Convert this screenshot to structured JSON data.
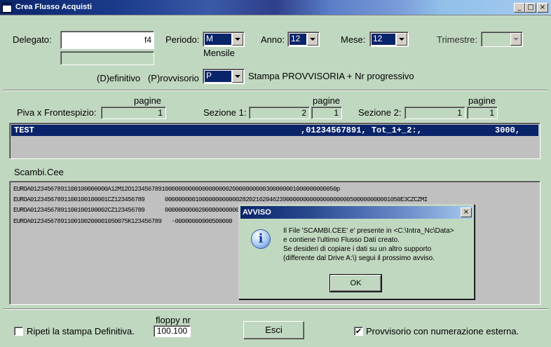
{
  "window": {
    "title": "Crea Flusso Acquisti",
    "min": "_",
    "max": "□",
    "close": "×"
  },
  "form": {
    "delegato_label": "Delegato:",
    "delegato_value": "",
    "delegato_fkey": "f4",
    "delegato_desc": "",
    "periodo_label": "Periodo:",
    "periodo_value": "M",
    "periodo_desc": "Mensile",
    "anno_label": "Anno:",
    "anno_value": "12",
    "mese_label": "Mese:",
    "mese_value": "12",
    "trimestre_label": "Trimestre:",
    "trimestre_value": "",
    "tipo_label": "(D)efinitivo   (P)rovvisorio",
    "tipo_value": "P",
    "tipo_desc": "Stampa PROVVISORIA + Nr progressivo"
  },
  "pages": {
    "pagine_label": "pagine",
    "frontespizio_label": "Piva x Frontespizio:",
    "frontespizio_value": "1",
    "sezione1_label": "Sezione 1:",
    "sezione1_value": "2",
    "sezione1_pages": "1",
    "sezione2_label": "Sezione 2:",
    "sezione2_value": "1",
    "sezione2_pages": "1"
  },
  "list": {
    "row_name": "TEST",
    "row_code": ",01234567891, Tot_1+_2:,",
    "row_total": "3000,"
  },
  "scambi": {
    "label": "Scambi.Cee",
    "lines": [
      "EUROA01234567891100100000000A12M12O1234567891000000000000000000020000000000300000001000000000050p",
      "EUROA01234567891100100100001CZ123456789      0000000001000000000000282021620462390000000000000000000500000000001050E3CZCZMI",
      "EUROA01234567891100100100002CZ123456789      00000000002000000000005",
      "EUROA01234567891100100200001050075K123456789   -00000000000500000"
    ]
  },
  "footer": {
    "repeat_label": "Ripeti la stampa Definitiva.",
    "repeat_checked": false,
    "floppy_label": "floppy nr",
    "floppy_value": "100.100",
    "esci_label": "Esci",
    "provv_label": "Provvisorio con numerazione esterna.",
    "provv_checked": true,
    "check_mark": "✔"
  },
  "dialog": {
    "title": "AVVISO",
    "close": "×",
    "icon_glyph": "i",
    "lines": [
      "Il File 'SCAMBI.CEE' e' presente in <C:\\Intra_Nc\\Data>",
      "e contiene l'ultimo Flusso Dati creato.",
      "Se desideri di copiare i dati su un altro supporto",
      "(differente dal Drive A:\\) segui il prossimo avviso."
    ],
    "ok_label": "OK"
  },
  "colors": {
    "selection": "#0a246a",
    "face": "#c0d8c0",
    "title_start": "#0a246a",
    "title_end": "#a6caf0"
  }
}
